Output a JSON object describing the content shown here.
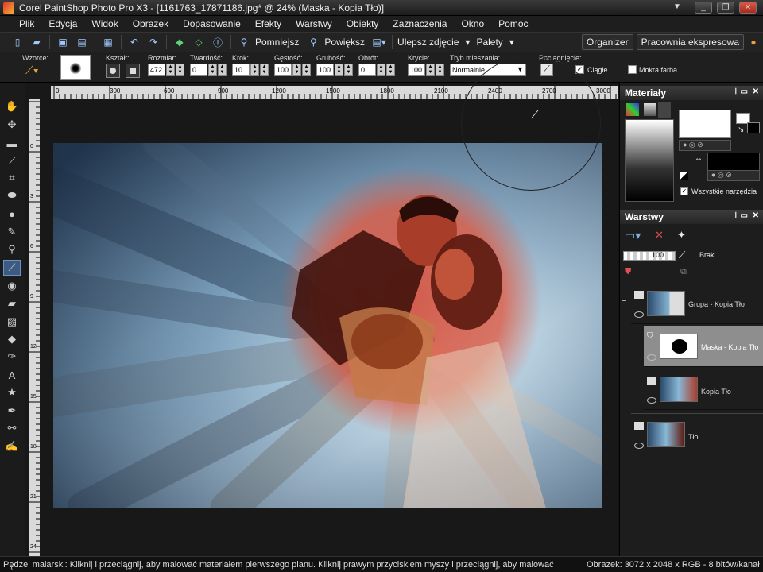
{
  "window": {
    "title": "Corel PaintShop Photo Pro X3 - [1161763_17871186.jpg* @  24% (Maska - Kopia Tło)]",
    "controls": [
      "▼",
      "_",
      "❐",
      "✕"
    ]
  },
  "menu": [
    "Plik",
    "Edycja",
    "Widok",
    "Obrazek",
    "Dopasowanie",
    "Efekty",
    "Warstwy",
    "Obiekty",
    "Zaznaczenia",
    "Okno",
    "Pomoc"
  ],
  "toolbar": {
    "zoom_out": "Pomniejsz",
    "zoom_in": "Powiększ",
    "enhance": "Ulepsz zdjęcie",
    "palettes": "Palety",
    "organizer": "Organizer",
    "workspace": "Pracownia ekspresowa"
  },
  "tool_options": {
    "preset_label": "Wzorce:",
    "shape_label": "Kształt:",
    "size_label": "Rozmiar:",
    "size_value": "472",
    "hardness_label": "Twardość:",
    "hardness_value": "0",
    "step_label": "Krok:",
    "step_value": "10",
    "density_label": "Gęstość:",
    "density_value": "100",
    "thickness_label": "Grubość:",
    "thickness_value": "100",
    "rotation_label": "Obrót:",
    "rotation_value": "0",
    "opacity_label": "Krycie:",
    "opacity_value": "100",
    "blend_label": "Tryb mieszania:",
    "blend_value": "Normalnie",
    "stroke_label": "Pociągnięcie:",
    "continuous_label": "Ciągłe",
    "wet_label": "Mokra farba"
  },
  "ruler": {
    "h_labels": [
      "0",
      "300",
      "600",
      "900",
      "1200",
      "1500",
      "1800",
      "2100",
      "2400",
      "2700",
      "3000"
    ],
    "v_labels": [
      "0",
      "3",
      "6",
      "9",
      "12",
      "15",
      "18",
      "21",
      "24",
      "27"
    ]
  },
  "materials": {
    "title": "Materiały",
    "all_tools_label": "Wszystkie narzędzia"
  },
  "layers": {
    "title": "Warstwy",
    "opacity_value": "100",
    "blend_label": "Brak",
    "items": [
      {
        "name": "Grupa - Kopia Tło"
      },
      {
        "name": "Maska - Kopia Tło"
      },
      {
        "name": "Kopia Tło"
      },
      {
        "name": "Tło"
      }
    ]
  },
  "status": {
    "hint": "Pędzel malarski: Kliknij i przeciągnij, aby malować materiałem pierwszego planu. Kliknij prawym przyciskiem myszy i przeciągnij, aby malować",
    "image_info": "Obrazek:  3072 x 2048 x RGB - 8 bitów/kanał"
  },
  "colors": {
    "accent": "#3d5a80",
    "panel": "#1d1d1d",
    "mask_overlay": "#e0543a"
  }
}
